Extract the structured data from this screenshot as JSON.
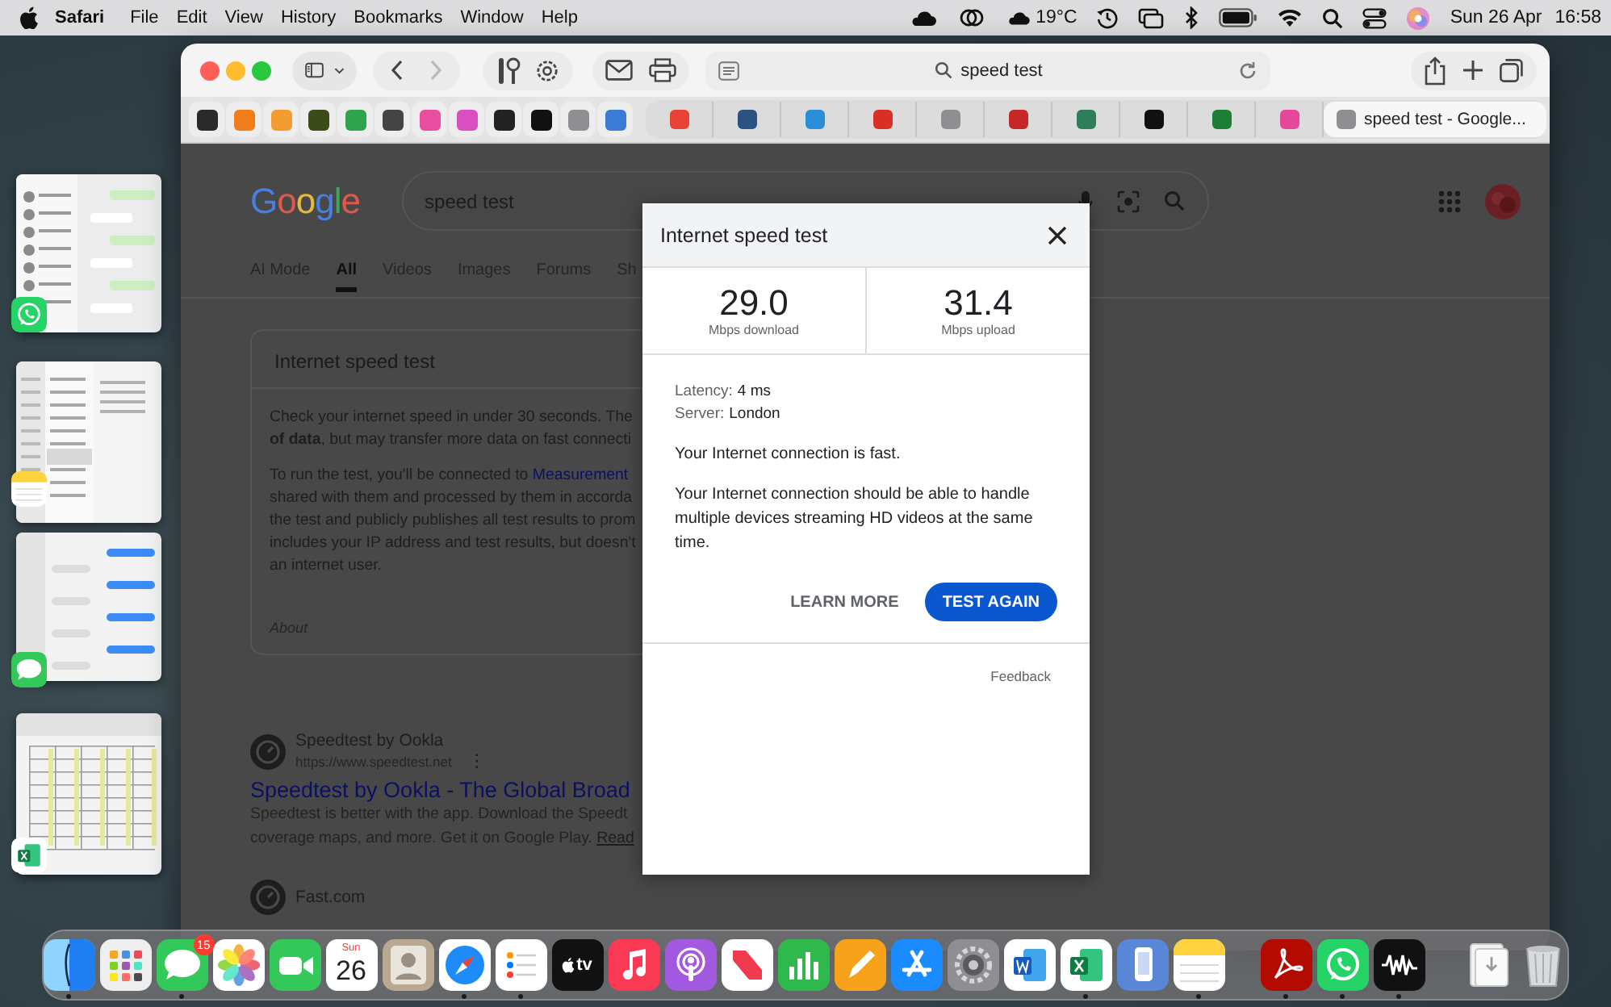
{
  "menu_bar": {
    "app": "Safari",
    "menus": [
      "File",
      "Edit",
      "View",
      "History",
      "Bookmarks",
      "Window",
      "Help"
    ],
    "weather": "19°C",
    "date": "Sun 26 Apr",
    "time": "16:58"
  },
  "stage_manager": [
    {
      "kind": "whatsapp"
    },
    {
      "kind": "notes"
    },
    {
      "kind": "messages"
    },
    {
      "kind": "excel"
    }
  ],
  "browser": {
    "address": "speed test",
    "back_disabled": false,
    "forward_disabled": true,
    "pinned_tabs": [
      {
        "color": "#2a2a2a"
      },
      {
        "color": "#f07c1b"
      },
      {
        "color": "#f39c32"
      },
      {
        "color": "#3d4a1a"
      },
      {
        "color": "#2fa44f"
      },
      {
        "color": "#444444"
      },
      {
        "color": "#e84fa0"
      },
      {
        "color": "#d94fc0"
      },
      {
        "color": "#222222"
      },
      {
        "color": "#111111"
      },
      {
        "color": "#8e8e93"
      },
      {
        "color": "#3a7bd5"
      }
    ],
    "tabs": [
      {
        "color": "#ea4335",
        "selected": false
      },
      {
        "color": "#2c5282",
        "selected": false
      },
      {
        "color": "#2a8fd8",
        "selected": false
      },
      {
        "color": "#d93025",
        "selected": false
      },
      {
        "color": "#8e8e93",
        "selected": false
      },
      {
        "color": "#c62828",
        "selected": false
      },
      {
        "color": "#2e7d5b",
        "selected": false
      },
      {
        "color": "#111111",
        "selected": false
      },
      {
        "color": "#1e7e34",
        "selected": false
      },
      {
        "color": "#e5479b",
        "selected": false
      },
      {
        "title": "speed test - Google...",
        "color": "#8e8e93",
        "selected": true
      }
    ]
  },
  "search_page": {
    "logo": "Google",
    "query": "speed test",
    "tabs": [
      {
        "label": "AI Mode",
        "selected": false
      },
      {
        "label": "All",
        "selected": true
      },
      {
        "label": "Videos",
        "selected": false
      },
      {
        "label": "Images",
        "selected": false
      },
      {
        "label": "Forums",
        "selected": false
      },
      {
        "label": "Sh",
        "selected": false
      }
    ],
    "card": {
      "title": "Internet speed test",
      "paragraphs": [
        [
          {
            "text": "Check your internet speed in under 30 seconds. The"
          },
          {
            "text": "**of data**, but may transfer more data on fast connecti"
          }
        ],
        [
          {
            "text": "To run the test, you'll be connected to ",
            "link": "Measurement"
          },
          {
            "text": "shared with them and processed by them in accorda"
          },
          {
            "text": "the test and publicly publishes all test results to prom"
          },
          {
            "text": "includes your IP address and test results, but doesn't"
          },
          {
            "text": "an internet user."
          }
        ]
      ],
      "about": "About"
    },
    "results": [
      {
        "site": "Speedtest by Ookla",
        "url": "https://www.speedtest.net",
        "menu": "⋮",
        "title": "Speedtest by Ookla - The Global Broad",
        "snippet": [
          {
            "text": "Speedtest is better with the app. Download the Speedt"
          },
          {
            "text": "coverage maps, and more. Get it on Google Play. ",
            "link": "Read"
          }
        ]
      },
      {
        "site": "Fast.com"
      }
    ]
  },
  "dialog": {
    "title": "Internet speed test",
    "stats": [
      {
        "value": "29.0",
        "unit": "Mbps download"
      },
      {
        "value": "31.4",
        "unit": "Mbps upload"
      }
    ],
    "details": [
      {
        "label": "Latency:",
        "value": "4 ms"
      },
      {
        "label": "Server:",
        "value": "London"
      }
    ],
    "verdict": "Your Internet connection is fast.",
    "description": "Your Internet connection should be able to handle multiple devices streaming HD videos at the same time.",
    "buttons": [
      {
        "label": "LEARN MORE",
        "kind": "text"
      },
      {
        "label": "TEST AGAIN",
        "kind": "primary"
      }
    ],
    "feedback": "Feedback"
  },
  "dock": {
    "sections": [
      [
        {
          "kind": "finder",
          "running": true
        },
        {
          "kind": "launchpad",
          "running": false
        },
        {
          "kind": "messages",
          "running": true,
          "badge": "15"
        },
        {
          "kind": "photos",
          "running": false
        },
        {
          "kind": "facetime",
          "running": false
        },
        {
          "kind": "calendar",
          "running": false,
          "day": "Sun",
          "date": "26"
        },
        {
          "kind": "contacts",
          "running": false
        },
        {
          "kind": "safari",
          "running": true
        },
        {
          "kind": "reminders",
          "running": true
        },
        {
          "kind": "tv",
          "running": false,
          "label": "tv"
        },
        {
          "kind": "music",
          "running": false
        },
        {
          "kind": "podcasts",
          "running": false
        },
        {
          "kind": "news",
          "running": false
        },
        {
          "kind": "numbers",
          "running": false
        },
        {
          "kind": "pages",
          "running": false
        },
        {
          "kind": "appstore",
          "running": false
        },
        {
          "kind": "settings",
          "running": false
        },
        {
          "kind": "word",
          "running": false
        },
        {
          "kind": "excel",
          "running": true
        },
        {
          "kind": "files",
          "running": false
        },
        {
          "kind": "notes",
          "running": true
        }
      ],
      [
        {
          "kind": "acrobat",
          "running": true
        },
        {
          "kind": "whatsapp",
          "running": true
        },
        {
          "kind": "waveform",
          "running": true
        }
      ],
      [
        {
          "kind": "downloads",
          "running": false
        },
        {
          "kind": "trash",
          "running": false
        }
      ]
    ]
  }
}
